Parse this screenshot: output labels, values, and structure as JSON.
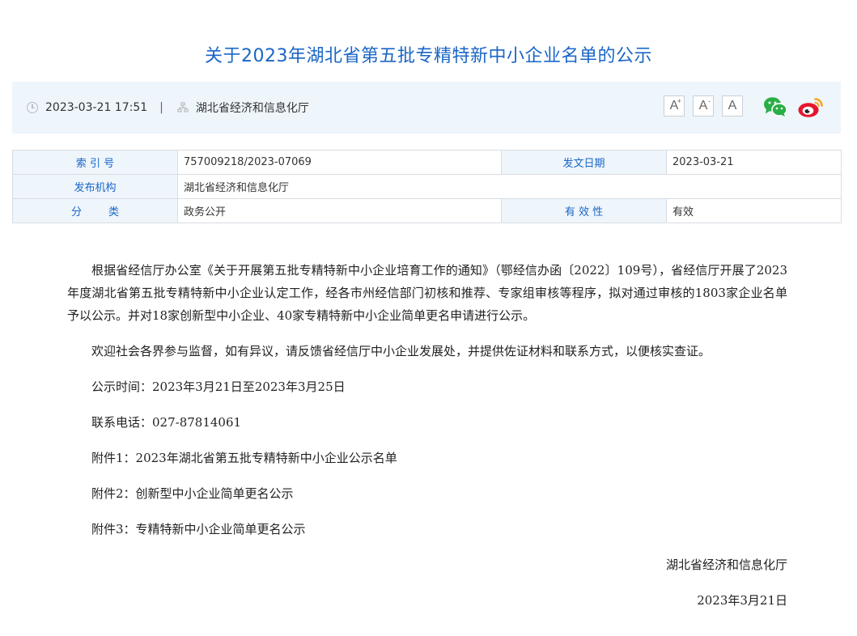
{
  "article": {
    "title": "关于2023年湖北省第五批专精特新中小企业名单的公示",
    "datetime": "2023-03-21 17:51",
    "separator": "|",
    "publisher": "湖北省经济和信息化厅"
  },
  "toolbar": {
    "font_large": "A",
    "font_large_sup": "+",
    "font_small": "A",
    "font_small_sup": "-",
    "font_reset": "A"
  },
  "colors": {
    "accent": "#1a66c7",
    "meta_bg": "#eef5fb",
    "wechat": "#2aae47",
    "weibo_red": "#e6162d",
    "weibo_orange": "#f5a623"
  },
  "info_table": {
    "index_label": "索 引 号",
    "index_value": "757009218/2023-07069",
    "date_label": "发文日期",
    "date_value": "2023-03-21",
    "org_label": "发布机构",
    "org_value": "湖北省经济和信息化厅",
    "category_label": "分        类",
    "category_value": "政务公开",
    "validity_label": "有 效 性",
    "validity_value": "有效"
  },
  "body": {
    "p1": "根据省经信厅办公室《关于开展第五批专精特新中小企业培育工作的通知》（鄂经信办函〔2022〕109号），省经信厅开展了2023年度湖北省第五批专精特新中小企业认定工作，经各市州经信部门初核和推荐、专家组审核等程序，拟对通过审核的1803家企业名单予以公示。并对18家创新型中小企业、40家专精特新中小企业简单更名申请进行公示。",
    "p2": "欢迎社会各界参与监督，如有异议，请反馈省经信厅中小企业发展处，并提供佐证材料和联系方式，以便核实查证。",
    "period": "公示时间：2023年3月21日至2023年3月25日",
    "phone": "联系电话：027-87814061",
    "attachment1": "附件1：2023年湖北省第五批专精特新中小企业公示名单",
    "attachment2": "附件2：创新型中小企业简单更名公示",
    "attachment3": "附件3：专精特新中小企业简单更名公示",
    "signature": "湖北省经济和信息化厅",
    "sign_date": "2023年3月21日"
  }
}
